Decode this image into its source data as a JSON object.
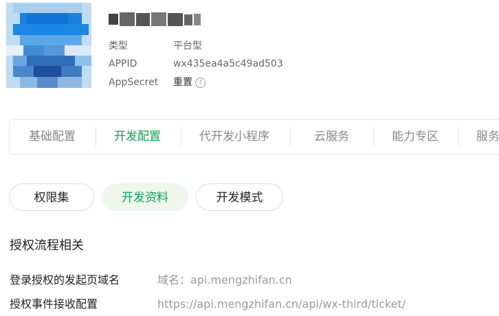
{
  "account": {
    "type_label": "类型",
    "type_value": "平台型",
    "appid_label": "APPID",
    "appid_value": "wx435ea4a5c49ad503",
    "secret_label": "AppSecret",
    "secret_action": "重置",
    "help_icon": "?"
  },
  "tabs": [
    "基础配置",
    "开发配置",
    "代开发小程序",
    "云服务",
    "能力专区",
    "服务"
  ],
  "active_tab": "开发配置",
  "subtabs": [
    "权限集",
    "开发资料",
    "开发模式"
  ],
  "active_subtab": "开发资料",
  "section": {
    "title": "授权流程相关",
    "rows": [
      {
        "label": "登录授权的发起页域名",
        "value": "域名：api.mengzhifan.cn"
      },
      {
        "label": "授权事件接收配置",
        "value": "https://api.mengzhifan.cn/api/wx-third/ticket/"
      }
    ]
  },
  "colors": {
    "accent": "#07a855",
    "active_pill_bg": "#eef7ee"
  }
}
